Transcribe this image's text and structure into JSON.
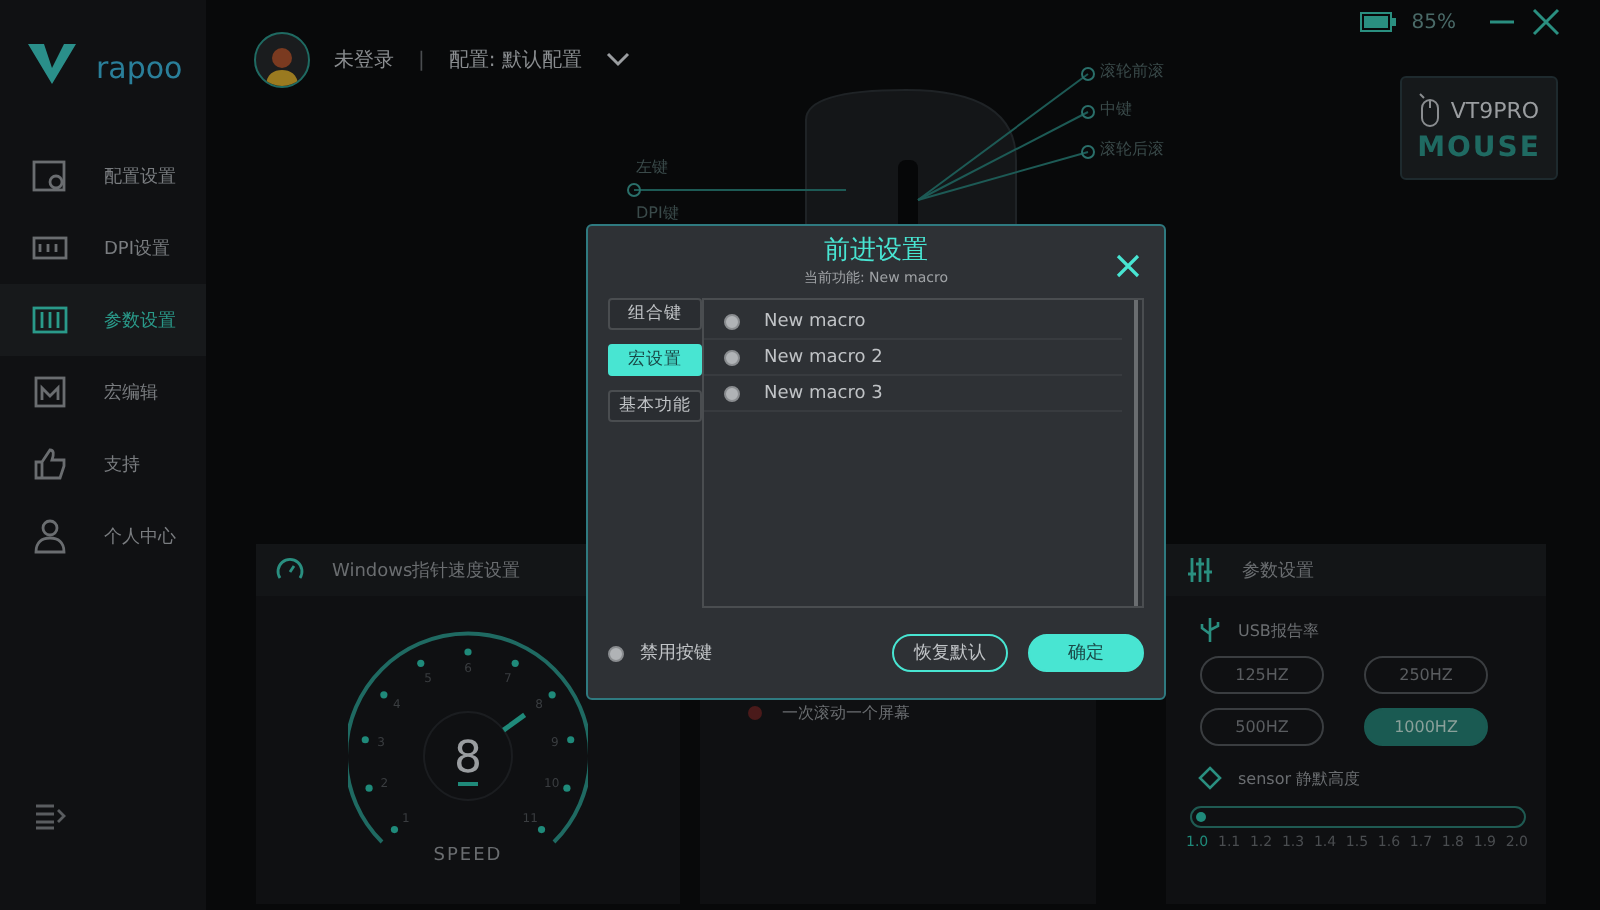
{
  "brand": "rapoo",
  "status": {
    "battery": "85%"
  },
  "sidebar": {
    "items": [
      {
        "label": "配置设置",
        "selected": false
      },
      {
        "label": "DPI设置",
        "selected": false
      },
      {
        "label": "参数设置",
        "selected": true
      },
      {
        "label": "宏编辑",
        "selected": false
      },
      {
        "label": "支持",
        "selected": false
      },
      {
        "label": "个人中心",
        "selected": false
      }
    ]
  },
  "header": {
    "user": "未登录",
    "separator": "|",
    "profile": "配置: 默认配置"
  },
  "device": {
    "model": "VT9PRO",
    "type": "MOUSE"
  },
  "mouse_labels": [
    {
      "label": "滚轮前滚"
    },
    {
      "label": "中键"
    },
    {
      "label": "滚轮后滚"
    },
    {
      "label": "左键"
    },
    {
      "label": "DPI键"
    }
  ],
  "pointer_panel": {
    "title": "Windows指针速度设置",
    "value": "8",
    "level": 0.7,
    "caption": "SPEED",
    "ticks": [
      "1",
      "2",
      "3",
      "4",
      "5",
      "6",
      "7",
      "8",
      "9",
      "10",
      "11"
    ]
  },
  "scroll_panel": {
    "options": [
      {
        "label": "一次滚动一个屏幕",
        "selected": false
      }
    ]
  },
  "param_panel": {
    "title": "参数设置",
    "usb_label": "USB报告率",
    "rates": [
      {
        "label": "125HZ",
        "selected": false
      },
      {
        "label": "250HZ",
        "selected": false
      },
      {
        "label": "500HZ",
        "selected": false
      },
      {
        "label": "1000HZ",
        "selected": true
      }
    ],
    "sensor_label": "sensor 静默高度",
    "level": 0,
    "ticks": [
      "1.0",
      "1.1",
      "1.2",
      "1.3",
      "1.4",
      "1.5",
      "1.6",
      "1.7",
      "1.8",
      "1.9",
      "2.0"
    ]
  },
  "dialog": {
    "title": "前进设置",
    "subtitle": "当前功能: New macro",
    "tabs": [
      {
        "label": "组合键",
        "selected": false
      },
      {
        "label": "宏设置",
        "selected": true
      },
      {
        "label": "基本功能",
        "selected": false
      }
    ],
    "macros": [
      {
        "label": "New macro",
        "selected": false
      },
      {
        "label": "New macro 2",
        "selected": false
      },
      {
        "label": "New macro 3",
        "selected": false
      }
    ],
    "disable_key": {
      "label": "禁用按键",
      "checked": false
    },
    "buttons": [
      {
        "label": "恢复默认",
        "kind": "secondary"
      },
      {
        "label": "确定",
        "kind": "primary"
      }
    ]
  }
}
